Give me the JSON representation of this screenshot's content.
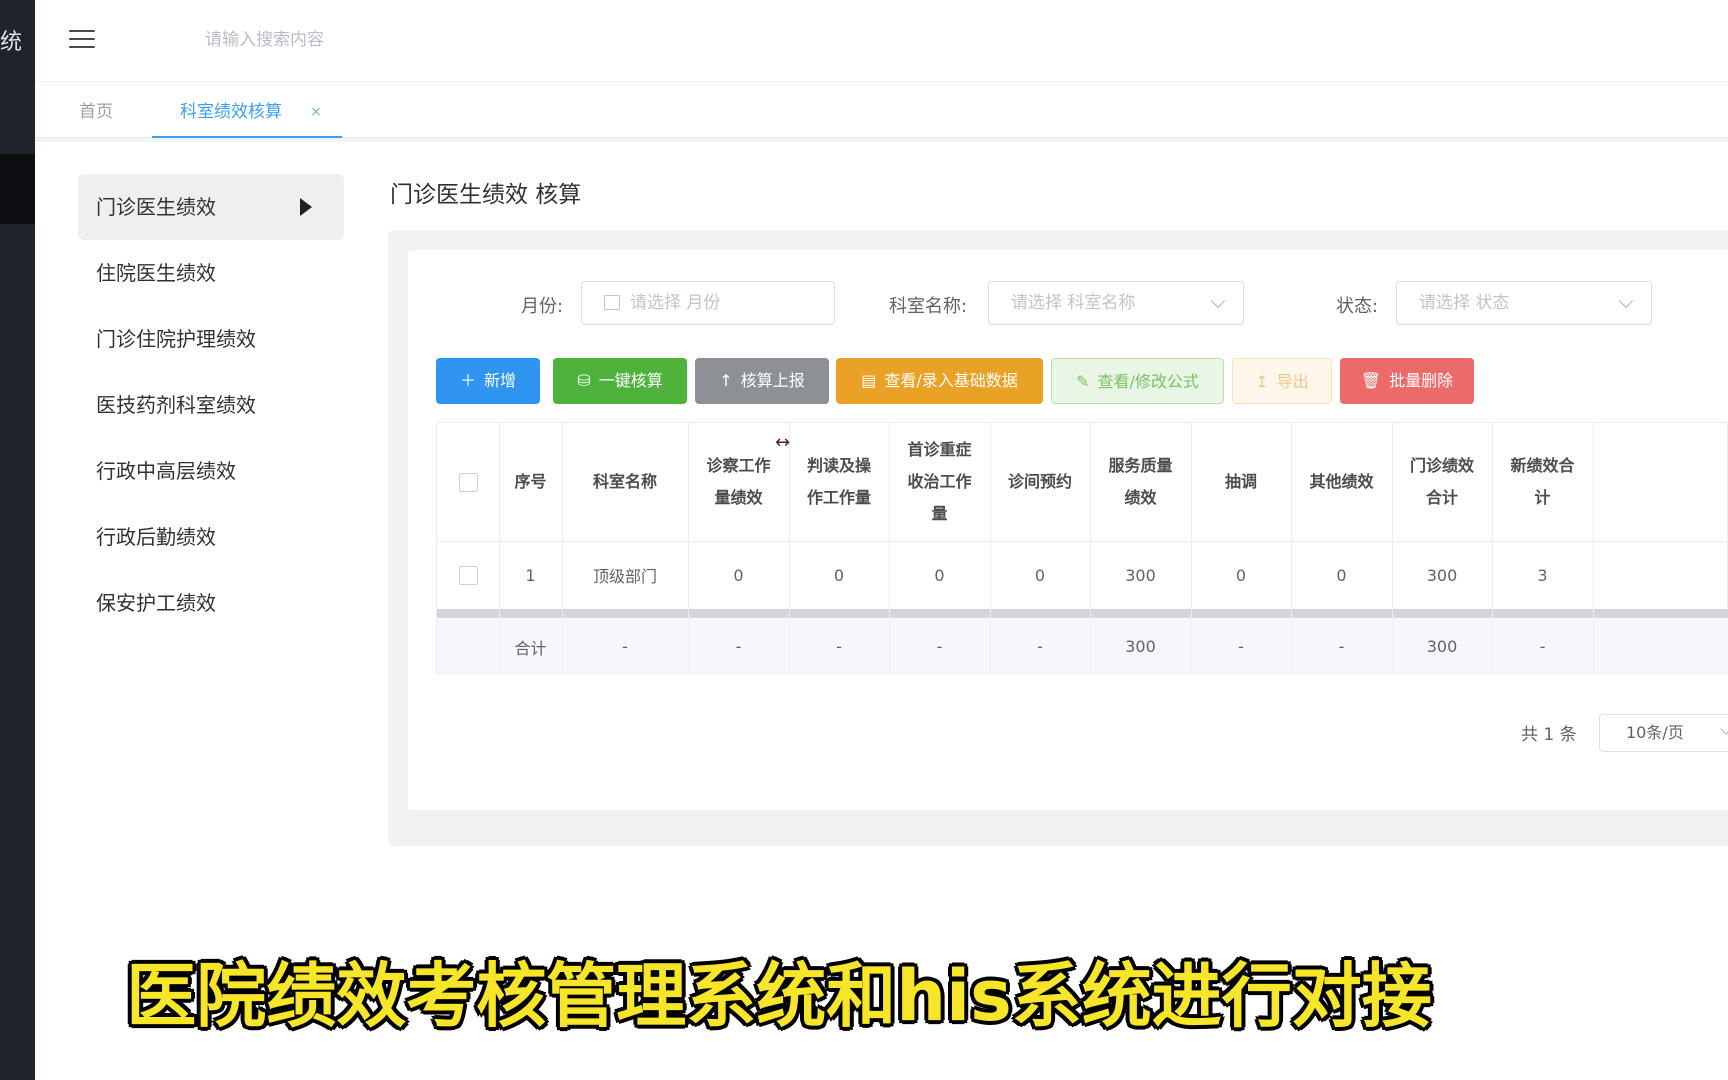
{
  "sidebar_brand_fragment": "统",
  "header": {
    "search_placeholder": "请输入搜索内容"
  },
  "tabs": [
    {
      "label": "首页"
    },
    {
      "label": "科室绩效核算",
      "close": "×"
    }
  ],
  "submenu": [
    {
      "label": "门诊医生绩效",
      "active": true
    },
    {
      "label": "住院医生绩效"
    },
    {
      "label": "门诊住院护理绩效"
    },
    {
      "label": "医技药剂科室绩效"
    },
    {
      "label": "行政中高层绩效"
    },
    {
      "label": "行政后勤绩效"
    },
    {
      "label": "保安护工绩效"
    }
  ],
  "main": {
    "title": "门诊医生绩效 核算"
  },
  "filters": {
    "month_label": "月份:",
    "month_placeholder": "请选择 月份",
    "dept_label": "科室名称:",
    "dept_placeholder": "请选择 科室名称",
    "status_label": "状态:",
    "status_placeholder": "请选择 状态"
  },
  "buttons": {
    "add": "新增",
    "calc": "一键核算",
    "report": "核算上报",
    "base_data": "查看/录入基础数据",
    "formula": "查看/修改公式",
    "export": "导出",
    "delete": "批量删除"
  },
  "table": {
    "headers": [
      "序号",
      "科室名称",
      "诊察工作量绩效",
      "判读及操作工作量",
      "首诊重症收治工作量",
      "诊间预约",
      "服务质量绩效",
      "抽调",
      "其他绩效",
      "门诊绩效合计",
      "新绩效合计"
    ],
    "rows": [
      [
        "1",
        "顶级部门",
        "0",
        "0",
        "0",
        "0",
        "300",
        "0",
        "0",
        "300",
        "3"
      ]
    ],
    "summary": [
      "合计",
      "-",
      "-",
      "-",
      "-",
      "-",
      "300",
      "-",
      "-",
      "300",
      "-"
    ]
  },
  "pagination": {
    "total": "共 1 条",
    "page_size": "10条/页"
  },
  "caption": "医院绩效考核管理系统和his系统进行对接",
  "colors": {
    "primary": "#2f95f1",
    "success": "#4db33d",
    "info": "#8d9196",
    "warning": "#eaa226",
    "danger": "#ed6a6a",
    "nav_dark": "#20232a"
  }
}
